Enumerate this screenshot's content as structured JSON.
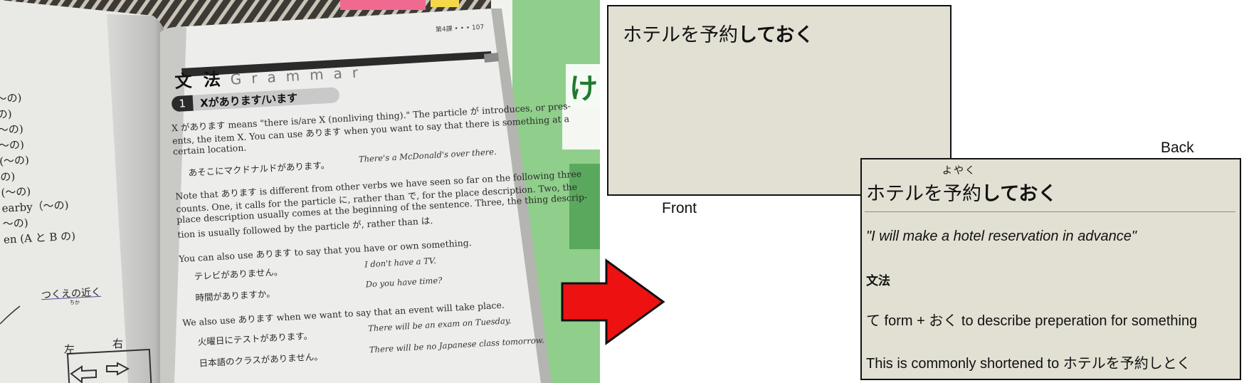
{
  "photo": {
    "left_page_lines": [
      "～の)",
      "の)",
      "～の)",
      "～の)",
      "(～の)",
      "の)",
      "(～の)",
      "earby（～の)",
      "～の)",
      "en (A と B の)"
    ],
    "tsukue_no_chikaku": "つくえの近く",
    "tsukue_furigana": "ちか",
    "hidari": "左",
    "migi": "右",
    "page_header": "第4課 • • • 107",
    "bunpo_title": "文 法",
    "grammar_title": "Grammar",
    "section_number": "1",
    "section_title": "Xがあります/います",
    "body": [
      "X があります means \"there is/are X (nonliving thing).\" The particle が introduces, or pres-",
      "ents, the item X. You can use あります when you want to say that there is something at a",
      "certain location."
    ],
    "ex1_jp": "あそこにマクドナルドがあります。",
    "ex1_en": "There's a McDonald's over there.",
    "note": [
      "Note that あります is different from other verbs we have seen so far on the following three",
      "counts. One, it calls for the particle に, rather than で, for the place description. Two, the",
      "place description usually comes at the beginning of the sentence. Three, the thing descrip-",
      "tion is usually followed by the particle が, rather than は."
    ],
    "possess_line": "You can also use あります to say that you have or own something.",
    "ex2_jp": "テレビがありません。",
    "ex2_en": "I don't have a TV.",
    "ex3_jp": "時間がありますか。",
    "ex3_en": "Do you have time?",
    "event_line": "We also use あります when we want to say that an event will take place.",
    "ex4_jp": "火曜日にテストがあります。",
    "ex4_en": "There will be an exam on Tuesday.",
    "ex5_jp": "日本語のクラスがありません。",
    "ex5_en": "There will be no Japanese class tomorrow.",
    "cover_text": "け GEN"
  },
  "front_card": {
    "term_plain": "ホテルを予約",
    "term_bold": "しておく",
    "label": "Front"
  },
  "back_card": {
    "label": "Back",
    "furigana": "よやく",
    "term_plain": "ホテルを予約",
    "term_bold": "しておく",
    "meaning": "\"I will make a hotel reservation in advance\"",
    "section": "文法",
    "rule": "て form + おく to describe preperation for something",
    "note": "This is commonly shortened to ホテルを予約しとく"
  },
  "colors": {
    "card_bg": "#e2e0d3",
    "arrow_red": "#ee1111",
    "page_paper": "#ededeb",
    "cover_green": "#8fcf8b"
  }
}
